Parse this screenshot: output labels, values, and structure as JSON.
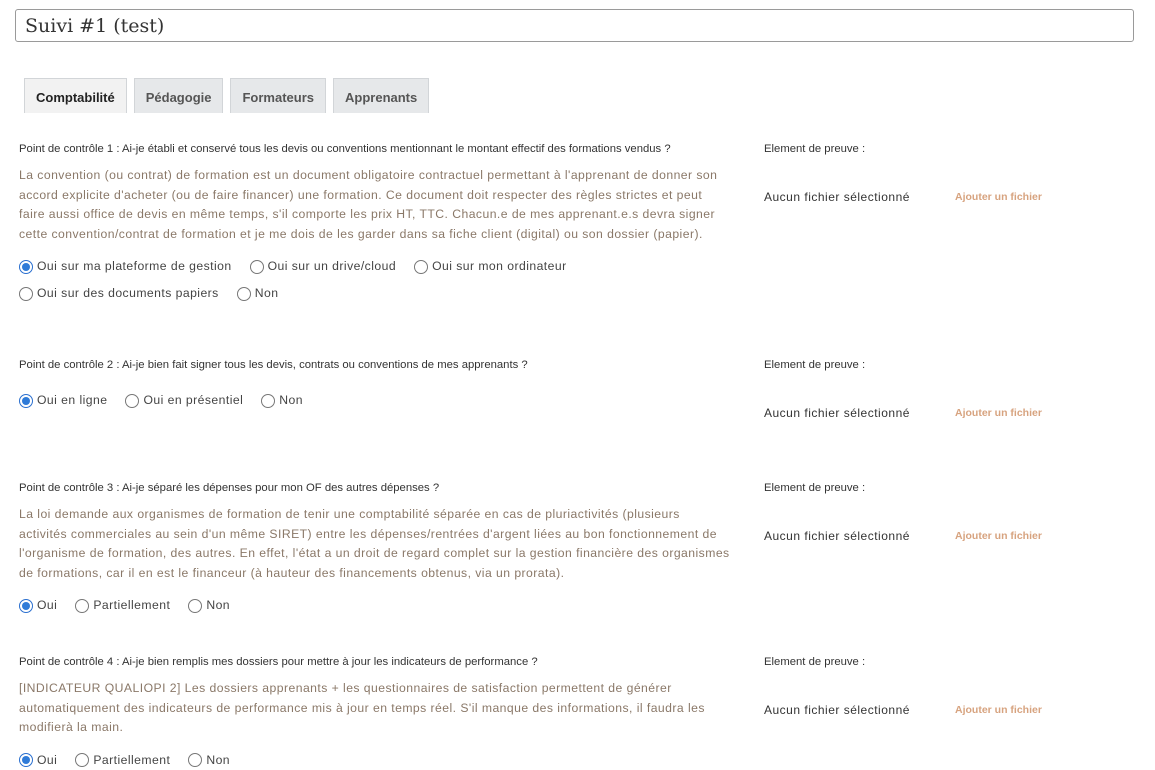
{
  "title_value": "Suivi #1 (test)",
  "tabs": [
    {
      "label": "Comptabilité",
      "active": true
    },
    {
      "label": "Pédagogie",
      "active": false
    },
    {
      "label": "Formateurs",
      "active": false
    },
    {
      "label": "Apprenants",
      "active": false
    }
  ],
  "proof": {
    "label": "Element de preuve :",
    "no_file": "Aucun fichier sélectionné",
    "add_file": "Ajouter un fichier"
  },
  "accent_color": "#2f7bd8",
  "questions": [
    {
      "question": "Point de contrôle 1 : Ai-je établi et conservé tous les devis ou conventions mentionnant le montant effectif des formations vendus ?",
      "description": "La convention (ou contrat) de formation est un document obligatoire contractuel permettant à l'apprenant de donner son accord explicite d'acheter (ou de faire financer) une formation. Ce document doit respecter des règles strictes et peut faire aussi office de devis en même temps, s'il comporte les prix HT, TTC. Chacun.e de mes apprenant.e.s devra signer cette convention/contrat de formation et je me dois de les garder dans sa fiche client (digital) ou son dossier (papier).",
      "options": [
        "Oui sur ma plateforme de gestion",
        "Oui sur un drive/cloud",
        "Oui sur mon ordinateur",
        "Oui sur des documents papiers",
        "Non"
      ],
      "selected": 0
    },
    {
      "question": "Point de contrôle 2 : Ai-je bien fait signer tous les devis, contrats ou conventions de mes apprenants ?",
      "description": "",
      "options": [
        "Oui en ligne",
        "Oui en présentiel",
        "Non"
      ],
      "selected": 0
    },
    {
      "question": "Point de contrôle 3 : Ai-je séparé les dépenses pour mon OF des autres dépenses ?",
      "description": "La loi demande aux organismes de formation de tenir une comptabilité séparée en cas de pluriactivités (plusieurs activités commerciales au sein d'un même SIRET) entre les dépenses/rentrées d'argent liées au bon fonctionnement de l'organisme de formation, des autres. En effet, l'état a un droit de regard complet sur la gestion financière des organismes de formations, car il en est le financeur (à hauteur des financements obtenus, via un prorata).",
      "options": [
        "Oui",
        "Partiellement",
        "Non"
      ],
      "selected": 0
    },
    {
      "question": "Point de contrôle 4 : Ai-je bien remplis mes dossiers pour mettre à jour les indicateurs de performance ?",
      "description": "[INDICATEUR QUALIOPI 2] Les dossiers apprenants + les questionnaires de satisfaction permettent de générer automatiquement des indicateurs de performance mis à jour en temps réel. S'il manque des informations, il faudra les modifierà la main.",
      "options": [
        "Oui",
        "Partiellement",
        "Non"
      ],
      "selected": 0
    }
  ]
}
